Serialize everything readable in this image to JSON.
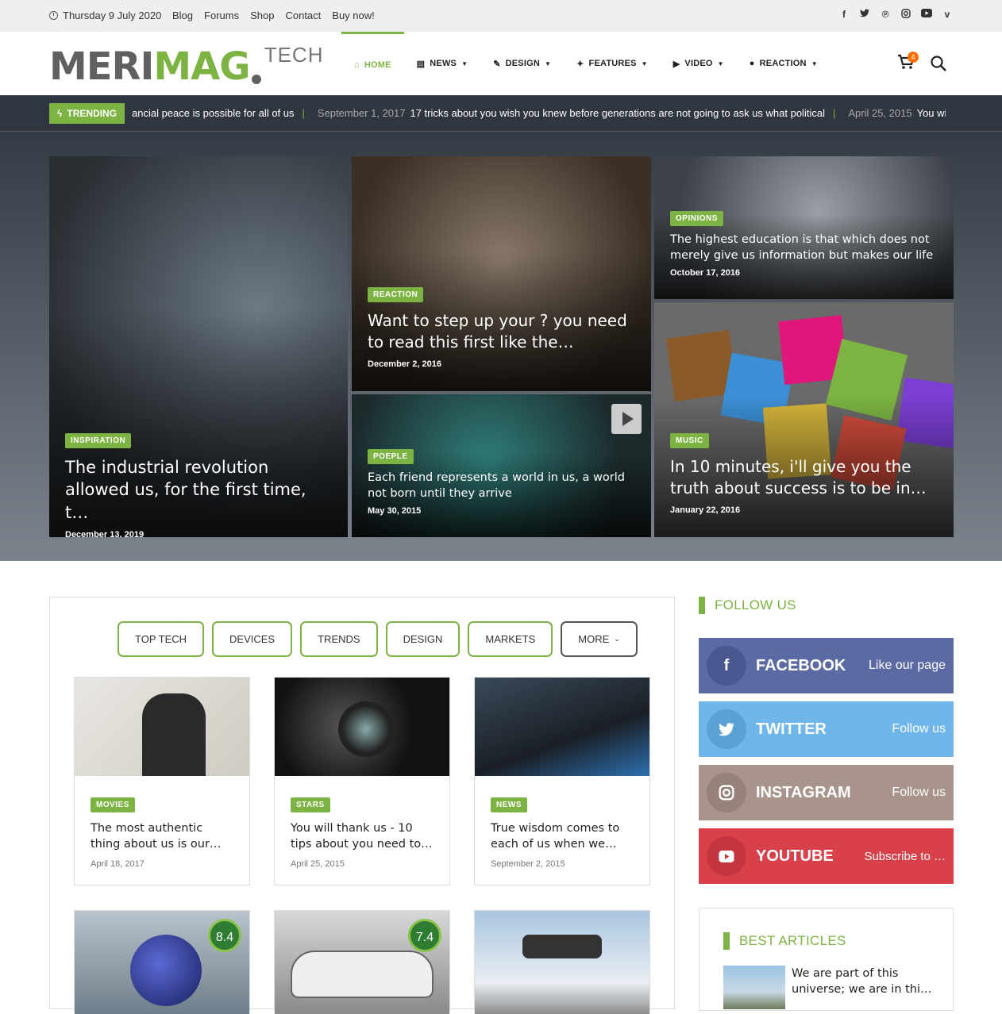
{
  "topbar": {
    "date": "Thursday 9 July 2020",
    "links": [
      "Blog",
      "Forums",
      "Shop",
      "Contact",
      "Buy now!"
    ],
    "social_icons": [
      "facebook-icon",
      "twitter-icon",
      "pinterest-icon",
      "instagram-icon",
      "youtube-icon",
      "vimeo-icon"
    ]
  },
  "logo": {
    "part1": "MERI",
    "part2": "MAG",
    "suffix": "TECH"
  },
  "nav": {
    "home": "HOME",
    "news": "NEWS",
    "design": "DESIGN",
    "features": "FEATURES",
    "video": "VIDEO",
    "reaction": "REACTION"
  },
  "cart": {
    "count": "4"
  },
  "trending": {
    "label": "TRENDING",
    "item1": "ancial peace is possible for all of us",
    "date2": "September 1, 2017",
    "item2": "17 tricks about you wish you knew before generations are not going to ask us what political",
    "date3": "April 25, 2015",
    "item3": "You wi"
  },
  "hero": {
    "c1": {
      "tag": "INSPIRATION",
      "title": "The industrial revolution allowed us, for the first time, t…",
      "date": "December 13, 2019"
    },
    "c2": {
      "tag": "REACTION",
      "title": "Want to step up your ? you need to read this first like the…",
      "date": "December 2, 2016"
    },
    "c3": {
      "tag": "OPINIONS",
      "title": "The highest education is that which does not merely give us information but makes our life",
      "date": "October 17, 2016"
    },
    "c4": {
      "tag": "POEPLE",
      "title": "Each friend represents a world in us, a world not born until they arrive",
      "date": "May 30, 2015"
    },
    "c5": {
      "tag": "MUSIC",
      "title": "In 10 minutes, i'll give you the truth about success is to be in…",
      "date": "January 22, 2016"
    }
  },
  "tabs": [
    "TOP TECH",
    "DEVICES",
    "TRENDS",
    "DESIGN",
    "MARKETS",
    "MORE"
  ],
  "posts": [
    {
      "tag": "MOVIES",
      "title": "The most authentic thing about us is our…",
      "date": "April 18, 2017"
    },
    {
      "tag": "STARS",
      "title": "You will thank us - 10 tips about you need to…",
      "date": "April 25, 2015"
    },
    {
      "tag": "NEWS",
      "title": "True wisdom comes to each of us when we…",
      "date": "September 2, 2015"
    }
  ],
  "scores": [
    "8.4",
    "7.4"
  ],
  "sidebar": {
    "follow_title": "FOLLOW US",
    "facebook": {
      "name": "FACEBOOK",
      "action": "Like our page",
      "color": "#5b6aa3"
    },
    "twitter": {
      "name": "TWITTER",
      "action": "Follow us",
      "color": "#6fb6ea"
    },
    "instagram": {
      "name": "INSTAGRAM",
      "action": "Follow us",
      "color": "#a8948a"
    },
    "youtube": {
      "name": "YOUTUBE",
      "action": "Subscribe to …",
      "color": "#d9414a"
    },
    "best_title": "BEST ARTICLES",
    "best_item": "We are part of this universe; we are in thi…"
  },
  "colors": {
    "accent": "#7cb342",
    "dark": "#2f3640"
  }
}
